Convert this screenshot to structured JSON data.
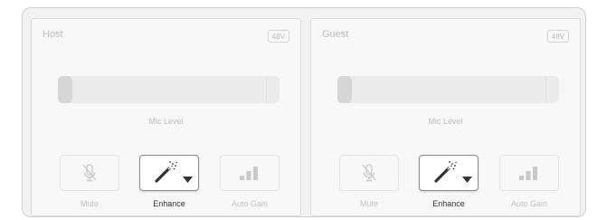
{
  "channels": [
    {
      "name": "Host",
      "phantom_badge": "48V",
      "slider_label": "Mic Level",
      "mic_level": 0,
      "buttons": {
        "mute": "Mute",
        "enhance": "Enhance",
        "auto_gain": "Auto Gain"
      },
      "enhance_active": true
    },
    {
      "name": "Guest",
      "phantom_badge": "48V",
      "slider_label": "Mic Level",
      "mic_level": 0,
      "buttons": {
        "mute": "Mute",
        "enhance": "Enhance",
        "auto_gain": "Auto Gain"
      },
      "enhance_active": true
    }
  ],
  "icons": {
    "mute": "mic-muted-icon",
    "enhance": "magic-wand-icon",
    "enhance_dropdown": "triangle-down-icon",
    "auto_gain": "signal-bars-icon"
  },
  "colors": {
    "active_text": "#333333",
    "inactive_text": "#c2c2c2",
    "active_border": "#8c8c8c"
  }
}
